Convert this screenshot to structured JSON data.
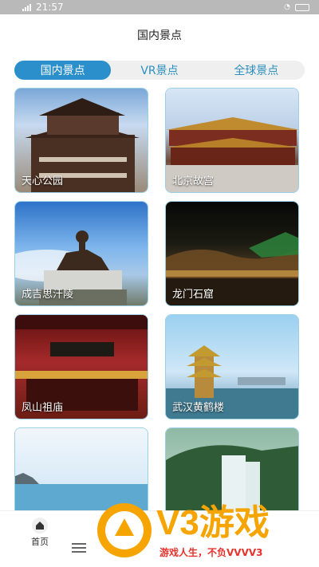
{
  "status_bar": {
    "time": "21:57"
  },
  "page": {
    "title": "国内景点"
  },
  "tabs": [
    {
      "label": "国内景点",
      "active": true
    },
    {
      "label": "VR景点",
      "active": false
    },
    {
      "label": "全球景点",
      "active": false
    }
  ],
  "spots": [
    {
      "label": "天心公园",
      "scene": "temple"
    },
    {
      "label": "北京故宫",
      "scene": "palace"
    },
    {
      "label": "成吉思汗陵",
      "scene": "statue"
    },
    {
      "label": "龙门石窟",
      "scene": "night"
    },
    {
      "label": "凤山祖庙",
      "scene": "shrine"
    },
    {
      "label": "武汉黄鹤楼",
      "scene": "tower"
    },
    {
      "label": "",
      "scene": "beach"
    },
    {
      "label": "",
      "scene": "falls"
    }
  ],
  "bottom_nav": {
    "home_label": "首页"
  },
  "watermark": {
    "brand": "V3游戏",
    "slogan": "游戏人生，不负VVVV3"
  },
  "colors": {
    "accent": "#2a8fcb",
    "watermark": "#e6322c"
  }
}
